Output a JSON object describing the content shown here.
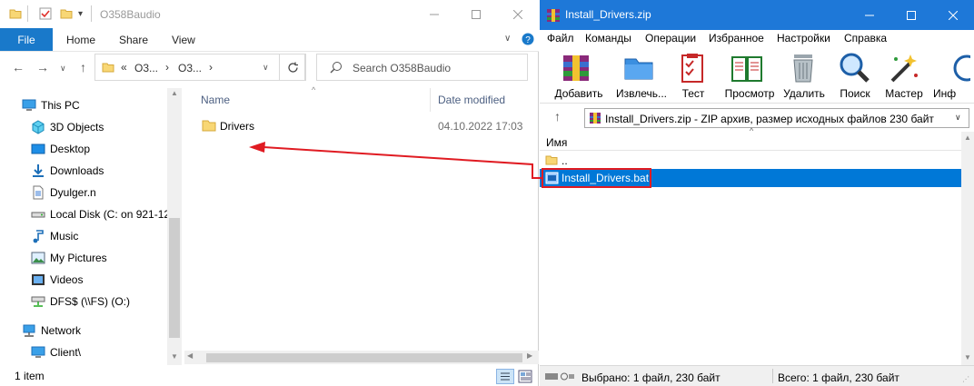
{
  "explorer": {
    "title": "O358Baudio",
    "ribbon": {
      "file": "File",
      "tabs": [
        "Home",
        "Share",
        "View"
      ]
    },
    "address": {
      "prefix": "«",
      "crumb1": "O3...",
      "crumb2": "O3..."
    },
    "search_placeholder": "Search O358Baudio",
    "sidebar": [
      {
        "label": "This PC",
        "icon": "computer-icon"
      },
      {
        "label": "3D Objects",
        "icon": "3d-objects-icon"
      },
      {
        "label": "Desktop",
        "icon": "desktop-icon"
      },
      {
        "label": "Downloads",
        "icon": "download-icon"
      },
      {
        "label": "Dyulger.n",
        "icon": "document-icon"
      },
      {
        "label": "Local Disk (C: on 921-12",
        "icon": "drive-icon"
      },
      {
        "label": "Music",
        "icon": "music-icon"
      },
      {
        "label": "My Pictures",
        "icon": "pictures-icon"
      },
      {
        "label": "Videos",
        "icon": "videos-icon"
      },
      {
        "label": "DFS$ (\\\\FS) (O:)",
        "icon": "network-drive-icon"
      },
      {
        "label": "Network",
        "icon": "network-icon"
      },
      {
        "label": "Client\\",
        "icon": "computer-icon"
      }
    ],
    "columns": {
      "name": "Name",
      "date": "Date modified"
    },
    "files": [
      {
        "name": "Drivers",
        "date": "04.10.2022 17:03",
        "icon": "folder-icon"
      }
    ],
    "status": "1 item"
  },
  "rar": {
    "title": "Install_Drivers.zip",
    "menu": [
      "Файл",
      "Команды",
      "Операции",
      "Избранное",
      "Настройки",
      "Справка"
    ],
    "toolbar": [
      "Добавить",
      "Извлечь...",
      "Тест",
      "Просмотр",
      "Удалить",
      "Поиск",
      "Мастер",
      "Инф"
    ],
    "path": "Install_Drivers.zip - ZIP архив, размер исходных файлов 230 байт",
    "column_name": "Имя",
    "items": [
      {
        "name": "..",
        "icon": "folder-up-icon"
      },
      {
        "name": "Install_Drivers.bat",
        "icon": "bat-file-icon",
        "selected": true
      }
    ],
    "status_selected": "Выбрано: 1 файл, 230 байт",
    "status_total": "Всего: 1 файл, 230 байт"
  },
  "colors": {
    "accent": "#1979ca",
    "rar_title": "#1e78d8",
    "selection": "#0078d7",
    "annotation": "#e01b22",
    "folder": "#f8d775"
  }
}
